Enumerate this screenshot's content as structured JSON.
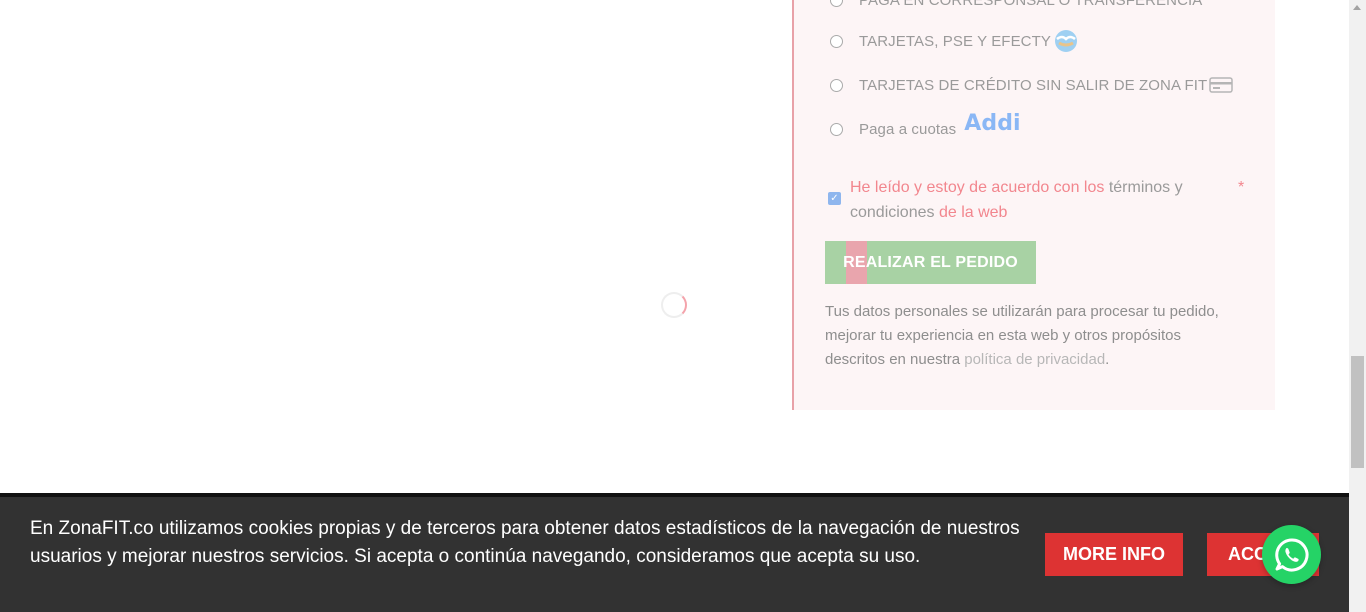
{
  "checkout": {
    "payment_options": [
      {
        "label": "PAGA EN CORRESPONSAL O TRANSFERENCIA",
        "icon": "none"
      },
      {
        "label": "TARJETAS, PSE Y EFECTY",
        "icon": "globe-handshake-icon"
      },
      {
        "label": "TARJETAS DE CRÉDITO SIN SALIR DE ZONA FIT",
        "icon": "credit-card-icon"
      },
      {
        "label": "Paga a cuotas",
        "icon": "addi-logo"
      }
    ],
    "addi_logo_text": "Addi",
    "terms": {
      "part1": "He leído y estoy de acuerdo con los",
      "part2": "términos y condiciones",
      "part3": "de la web",
      "required_mark": "*",
      "checked": true
    },
    "order_button_label": "REALIZAR EL PEDIDO",
    "privacy": {
      "text": "Tus datos personales se utilizarán para procesar tu pedido, mejorar tu experiencia en esta web y otros propósitos descritos en nuestra",
      "link": "política de privacidad",
      "end": "."
    }
  },
  "cookie_bar": {
    "text": "En ZonaFIT.co utilizamos cookies propias y de terceros para obtener datos estadísticos de la navegación de nuestros usuarios y mejorar nuestros servicios. Si acepta o continúa navegando, consideramos que acepta su uso.",
    "more_info_label": "MORE INFO",
    "accept_label": "ACCEPT"
  },
  "colors": {
    "accent_pink": "#f2868e",
    "order_button": "#a8d2a4",
    "cookie_button": "#dd3333",
    "whatsapp": "#25d366"
  }
}
